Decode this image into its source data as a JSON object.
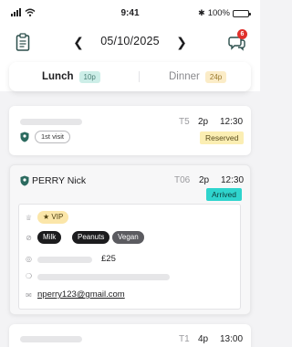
{
  "status_bar": {
    "time": "9:41",
    "battery": "100%"
  },
  "header": {
    "date": "05/10/2025",
    "prev_icon": "chevron-left-icon",
    "next_icon": "chevron-right-icon",
    "clipboard_icon": "clipboard-icon",
    "chat_icon": "chat-bubbles-icon",
    "notification_count": "6"
  },
  "tabs": [
    {
      "label": "Lunch",
      "count": "10p",
      "active": true
    },
    {
      "label": "Dinner",
      "count": "24p",
      "active": false
    }
  ],
  "reservations": [
    {
      "name": "",
      "table": "T5",
      "party": "2p",
      "time": "12:30",
      "status": "Reserved",
      "tag": "1st visit"
    },
    {
      "name": "PERRY Nick",
      "table": "T06",
      "party": "2p",
      "time": "12:30",
      "status": "Arrived",
      "details": {
        "vip_label": "★ VIP",
        "allergies": [
          "Milk",
          "Peanuts",
          "Vegan"
        ],
        "amount": "£25",
        "email": "nperry123@gmail.com"
      }
    },
    {
      "name": "",
      "table": "T1",
      "party": "4p",
      "time": "13:00",
      "status": ""
    }
  ],
  "colors": {
    "reserved": "#fbeeb3",
    "arrived": "#2fd4cd",
    "lunch_pill": "#cdeee8",
    "dinner_pill": "#fbecc7",
    "badge": "#e0302b"
  }
}
